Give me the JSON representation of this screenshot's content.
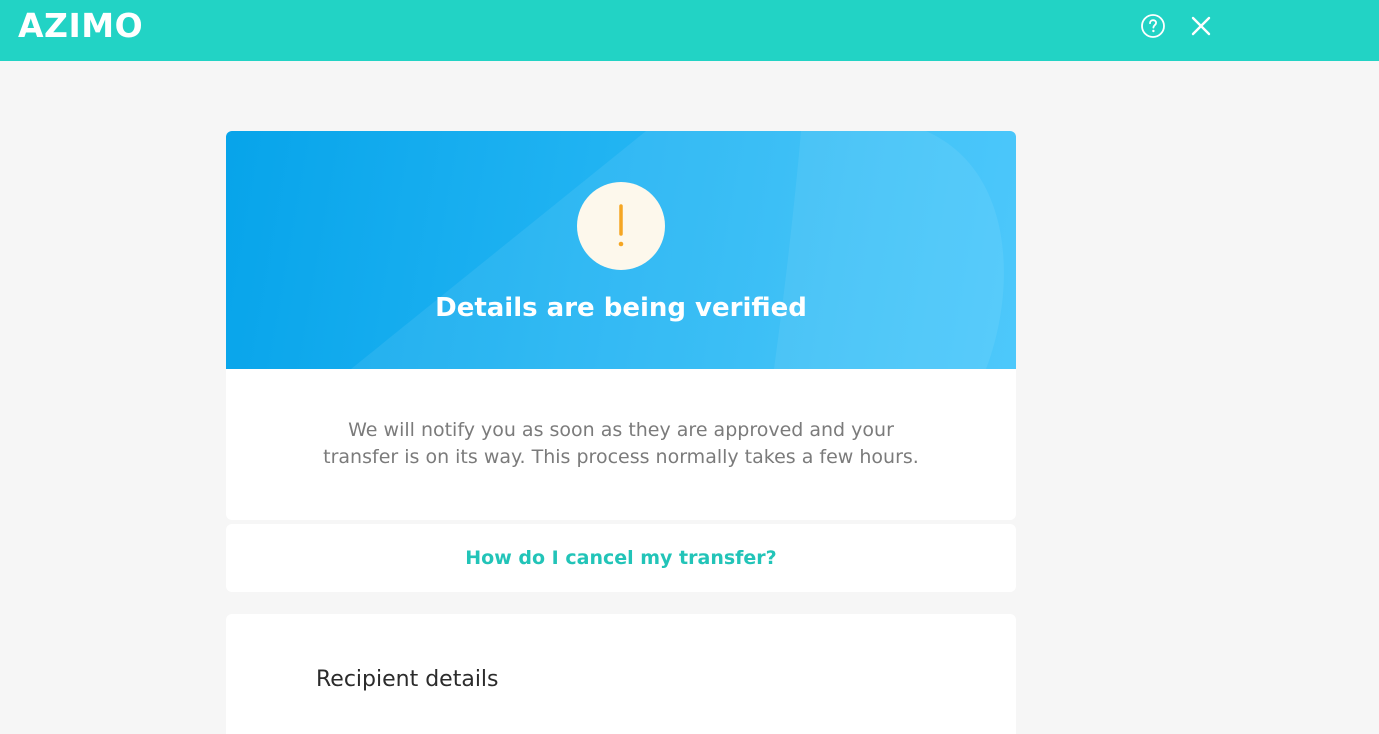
{
  "header": {
    "logo_text": "AZIMO",
    "brand_color": "#22d3c5",
    "help_icon": "question-circle-icon",
    "close_icon": "close-icon"
  },
  "status": {
    "icon": "exclamation-icon",
    "icon_color": "#f5a623",
    "title": "Details are being verified",
    "message": "We will notify you as soon as they are approved and your transfer is on its way. This process normally takes a few hours."
  },
  "help_link": {
    "label": "How do I cancel my transfer?",
    "color": "#22c4b8"
  },
  "recipient": {
    "section_title": "Recipient details"
  }
}
